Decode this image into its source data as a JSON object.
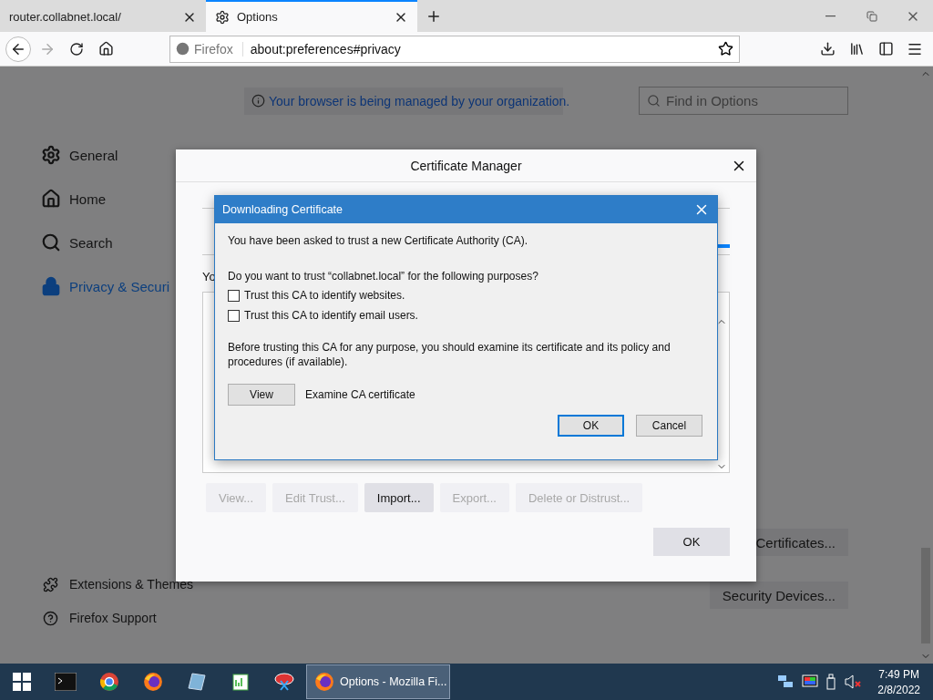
{
  "tabs": [
    {
      "title": "router.collabnet.local/",
      "selected": false
    },
    {
      "title": "Options",
      "selected": true
    }
  ],
  "toolbar": {
    "identity_label": "Firefox",
    "url": "about:preferences#privacy"
  },
  "notice": "Your browser is being managed by your organization.",
  "search": {
    "placeholder": "Find in Options"
  },
  "sidebar": {
    "items": [
      {
        "label": "General",
        "selected": false
      },
      {
        "label": "Home",
        "selected": false
      },
      {
        "label": "Search",
        "selected": false
      },
      {
        "label": "Privacy & Securi",
        "selected": true
      }
    ],
    "footer": [
      "Extensions & Themes",
      "Firefox Support"
    ]
  },
  "side_buttons": [
    "Certificates...",
    "Security Devices..."
  ],
  "certificate_manager": {
    "title": "Certificate Manager",
    "intro": "Yo",
    "buttons": [
      {
        "label": "View...",
        "disabled": true
      },
      {
        "label": "Edit Trust...",
        "disabled": true
      },
      {
        "label": "Import...",
        "disabled": false
      },
      {
        "label": "Export...",
        "disabled": true
      },
      {
        "label": "Delete or Distrust...",
        "disabled": true
      }
    ],
    "ok": "OK"
  },
  "download_dialog": {
    "title": "Downloading Certificate",
    "message": "You have been asked to trust a new Certificate Authority (CA).",
    "question": "Do you want to trust “collabnet.local” for the following purposes?",
    "options": [
      {
        "label": "Trust this CA to identify websites.",
        "checked": false
      },
      {
        "label": "Trust this CA to identify email users.",
        "checked": false
      }
    ],
    "advice": "Before trusting this CA for any purpose, you should examine its certificate and its policy and procedures (if available).",
    "view_button": "View",
    "view_label": "Examine CA certificate",
    "buttons": [
      {
        "label": "OK",
        "default": true
      },
      {
        "label": "Cancel",
        "default": false
      }
    ]
  },
  "taskbar": {
    "task": {
      "label": "Options - Mozilla Fi...",
      "selected": true
    },
    "time": "7:49 PM",
    "date": "2/8/2022"
  }
}
